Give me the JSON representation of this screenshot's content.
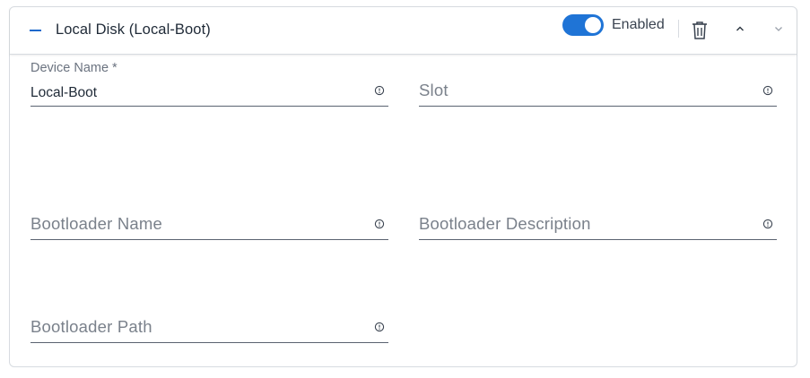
{
  "panel": {
    "title": "Local Disk (Local-Boot)",
    "toggle_label": "Enabled",
    "toggle_on": true,
    "accent_color": "#1f74d6",
    "icons": {
      "collapse": "minus-icon",
      "delete": "trash-icon",
      "move_up": "chevron-up-icon",
      "move_down": "chevron-down-icon",
      "field_info": "info-icon"
    }
  },
  "fields": {
    "device_name": {
      "label": "Device Name *",
      "value": "Local-Boot"
    },
    "slot": {
      "placeholder": "Slot",
      "value": ""
    },
    "bootloader_name": {
      "placeholder": "Bootloader Name",
      "value": ""
    },
    "bootloader_description": {
      "placeholder": "Bootloader Description",
      "value": ""
    },
    "bootloader_path": {
      "placeholder": "Bootloader Path",
      "value": ""
    }
  }
}
